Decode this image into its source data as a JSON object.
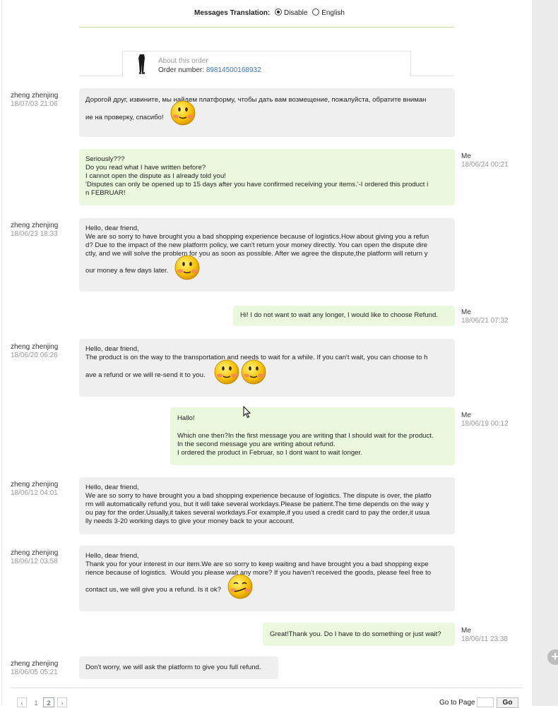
{
  "translation": {
    "label": "Messages Translation:",
    "options": [
      "Disable",
      "English"
    ],
    "selected": "Disable"
  },
  "order": {
    "about": "About this order",
    "number_label": "Order number:",
    "number": "89814500168932"
  },
  "messages": [
    {
      "dir": "in",
      "sender": "zheng zhenjing",
      "time": "18/07/03 21:06",
      "lines": [
        "Дорогой друг, извините, мы найдем платформу, чтобы дать вам возмещение, пожалуйста, обратите вниман",
        "ие на проверку, спасибо!"
      ],
      "emojis": 1
    },
    {
      "dir": "out",
      "sender": "Me",
      "time": "18/06/24 00:21",
      "lines": [
        "Seriously???",
        "Do you read what I have written before?",
        "I cannot open the dispute as I already told you!",
        "'Disputes can only be opened up to 15 days after you have confirmed receiving your items.'-I ordered this product i",
        "n FEBRUAR!"
      ],
      "emojis": 0
    },
    {
      "dir": "in",
      "sender": "zheng zhenjing",
      "time": "18/06/23 18:33",
      "lines": [
        "Hello, dear friend,",
        "We are so sorry to have brought you a bad shopping experience because of logistics.How about giving you a refun",
        "d? Due to the impact of the new platform policy, we can't return your money directly. You can open the dispute dire",
        "ctly, and we will solve the problem for you as soon as possible. After we agree the dispute,the platform will return y",
        "our money a few days later."
      ],
      "emojis": 1
    },
    {
      "dir": "out",
      "sender": "Me",
      "time": "18/06/21 07:32",
      "lines": [
        "Hi! I do not want to wait any longer, I would like to choose Refund."
      ],
      "emojis": 0
    },
    {
      "dir": "in",
      "sender": "zheng zhenjing",
      "time": "18/06/20 06:26",
      "lines": [
        "Hello, dear friend,",
        "The product is on the way to the transportation and needs to wait for a while. If you can't wait, you can choose to h",
        "ave a refund or we will re-send it to you."
      ],
      "emojis": 2
    },
    {
      "dir": "out",
      "sender": "Me",
      "time": "18/06/19 00:12",
      "lines": [
        "Hallo!",
        "",
        "Which one then?In the first message you are writing that I should wait for the product.",
        "In the second message you are writing about refund.",
        "I ordered the product in Februar, so I dont want to wait longer."
      ],
      "emojis": 0
    },
    {
      "dir": "in",
      "sender": "zheng zhenjing",
      "time": "18/06/12 04:01",
      "lines": [
        "Hello, dear friend,",
        "We are so sorry to have brought you a bad shopping experience because of logistics. The dispute is over, the platfo",
        "rm will automatically refund you, but it will take several workdays.Please be patient.The time depends on the way y",
        "ou pay for the order.Usually,it takes several workdays.For example,if you used a credit card to pay the order,it usua",
        "lly needs 3-20 working days to give your money back to your account."
      ],
      "emojis": 0
    },
    {
      "dir": "in",
      "sender": "zheng zhenjing",
      "time": "18/06/12 03:58",
      "lines": [
        "Hello, dear friend,",
        "Thank you for your interest in our item.We are so sorry to keep waiting and have brought you a bad shopping expe",
        "rience because of logistics.  Would you please wait any more? If you haven't received the goods, please feel free to",
        "contact us, we will give you a refund. Is it ok?"
      ],
      "emojis": 1
    },
    {
      "dir": "out",
      "sender": "Me",
      "time": "18/06/11 23:38",
      "lines": [
        "Great!Thank you. Do I have to do something or just wait?"
      ],
      "emojis": 0
    },
    {
      "dir": "in",
      "sender": "zheng zhenjing",
      "time": "18/06/05 05:21",
      "lines": [
        "Don't worry, we will ask the platform to give you full refund."
      ],
      "emojis": 0
    }
  ],
  "pagination": {
    "prev": "‹",
    "pages": [
      "1",
      "2"
    ],
    "current": "2",
    "next": "›",
    "goto_label": "Go to Page",
    "go_button": "Go"
  },
  "colors": {
    "incoming_bubble": "#efefef",
    "outgoing_bubble": "#eaf8dd",
    "link": "#3a76c4"
  }
}
